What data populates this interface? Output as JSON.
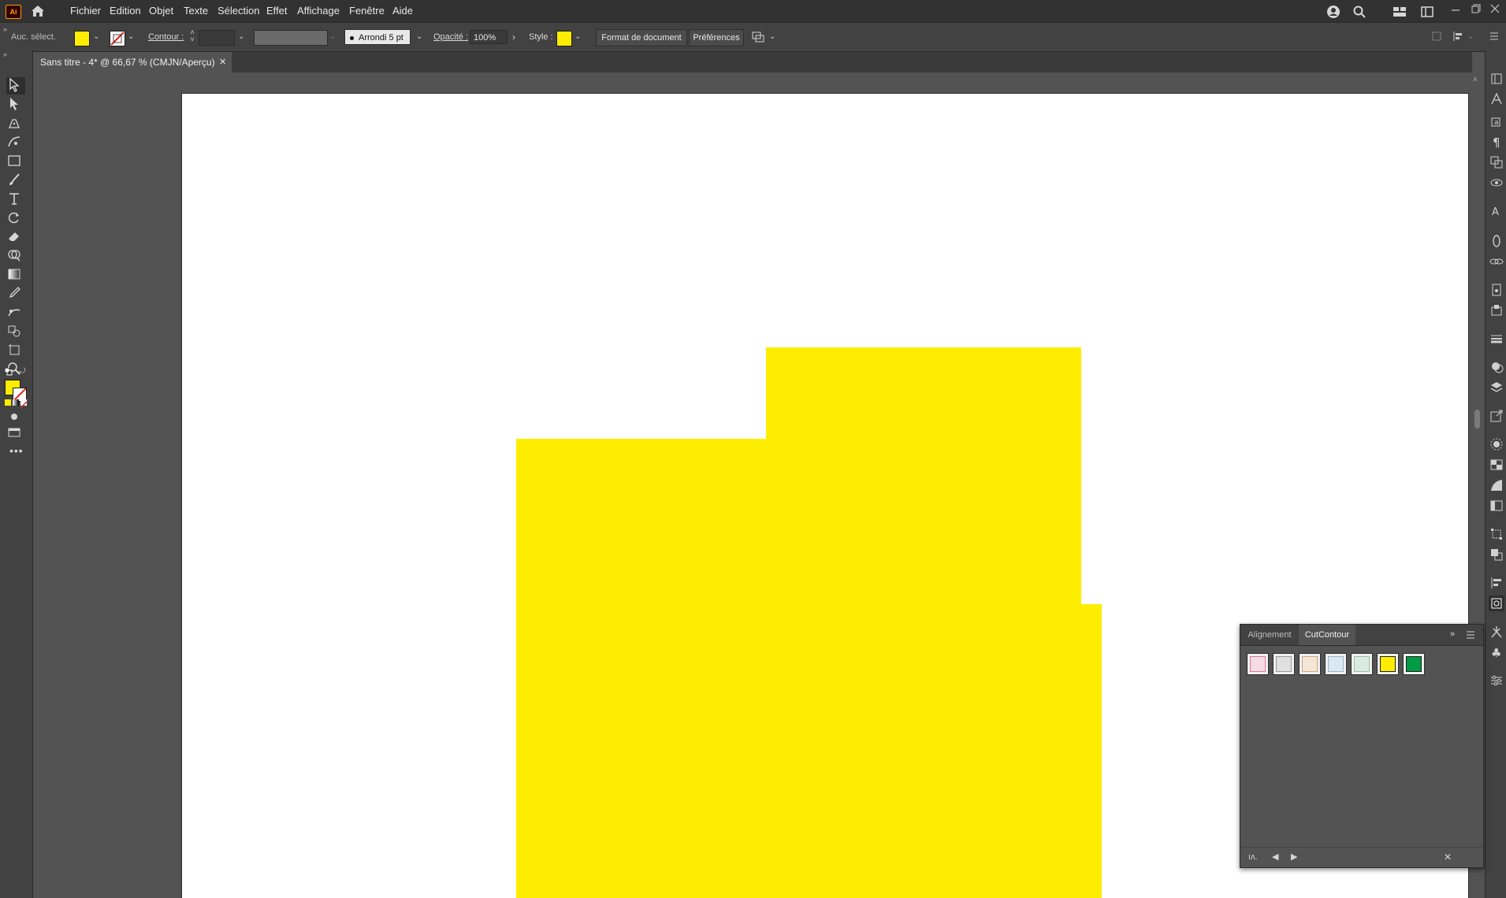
{
  "app": {
    "logo": "Ai"
  },
  "menu": [
    "Fichier",
    "Edition",
    "Objet",
    "Texte",
    "Sélection",
    "Effet",
    "Affichage",
    "Fenêtre",
    "Aide"
  ],
  "control": {
    "selection_label": "Auc. sélect.",
    "stroke_label": "Contour :",
    "brush_label": "Arrondi 5 pt",
    "opacity_label": "Opacité :",
    "opacity_value": "100%",
    "style_label": "Style :",
    "doc_format_button": "Format de document",
    "preferences_button": "Préférences",
    "fill_color": "#ffed00"
  },
  "document": {
    "tab_title": "Sans titre - 4* @ 66,67 % (CMJN/Aperçu)"
  },
  "artwork": {
    "shape_color": "#ffed00"
  },
  "panel": {
    "tabs": [
      "Alignement",
      "CutContour"
    ],
    "active_tab": "CutContour",
    "swatches": [
      {
        "color": "#f6dce4",
        "border": "#d87a98"
      },
      {
        "color": "#e0e0e0",
        "border": "#9a9a9a"
      },
      {
        "color": "#f4e6d6",
        "border": "#c9a98a"
      },
      {
        "color": "#dbe8f2",
        "border": "#9ab4c8"
      },
      {
        "color": "#dcebe2",
        "border": "#9cbfa8"
      },
      {
        "color": "#ffed00",
        "border": "#1f1f1f"
      },
      {
        "color": "#009a44",
        "border": "#1f1f1f"
      }
    ]
  }
}
